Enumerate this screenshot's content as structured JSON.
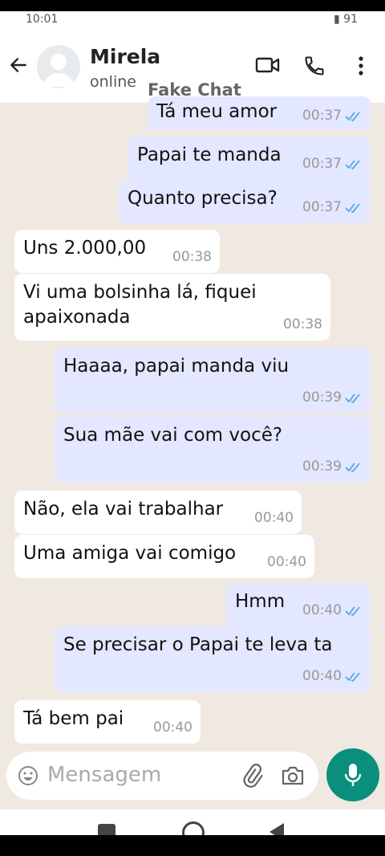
{
  "status_bar": {
    "time": "10:01",
    "battery": "91"
  },
  "header": {
    "contact_name": "Mirela",
    "contact_status": "online",
    "watermark": "Fake Chat"
  },
  "icons": {
    "back": "back-arrow-icon",
    "avatar": "default-avatar-icon",
    "video": "video-call-icon",
    "call": "phone-icon",
    "menu": "more-vert-icon",
    "emoji": "emoji-icon",
    "attach": "paperclip-icon",
    "camera": "camera-icon",
    "mic": "mic-icon"
  },
  "colors": {
    "incoming_bubble": "#ffffff",
    "outgoing_bubble": "#e3e7ff",
    "read_ticks": "#4fa9e8",
    "accent": "#0b8f7d",
    "chat_background": "#efe9e1"
  },
  "messages": [
    {
      "direction": "out",
      "text": "Tá meu amor",
      "time": "00:37",
      "read": true
    },
    {
      "direction": "out",
      "text": "Papai te manda",
      "time": "00:37",
      "read": true
    },
    {
      "direction": "out",
      "text": "Quanto precisa?",
      "time": "00:37",
      "read": true
    },
    {
      "direction": "in",
      "text": "Uns 2.000,00",
      "time": "00:38"
    },
    {
      "direction": "in",
      "text": "Vi uma bolsinha lá, fiquei\napaixonada",
      "time": "00:38"
    },
    {
      "direction": "out",
      "text": "Haaaa, papai manda viu",
      "time": "00:39",
      "read": true
    },
    {
      "direction": "out",
      "text": "Sua mãe vai com você?",
      "time": "00:39",
      "read": true
    },
    {
      "direction": "in",
      "text": "Não, ela vai trabalhar",
      "time": "00:40"
    },
    {
      "direction": "in",
      "text": "Uma amiga vai comigo",
      "time": "00:40"
    },
    {
      "direction": "out",
      "text": "Hmm",
      "time": "00:40",
      "read": true
    },
    {
      "direction": "out",
      "text": "Se precisar o Papai te leva ta",
      "time": "00:40",
      "read": true
    },
    {
      "direction": "in",
      "text": "Tá bem pai",
      "time": "00:40"
    }
  ],
  "composer": {
    "placeholder": "Mensagem"
  }
}
